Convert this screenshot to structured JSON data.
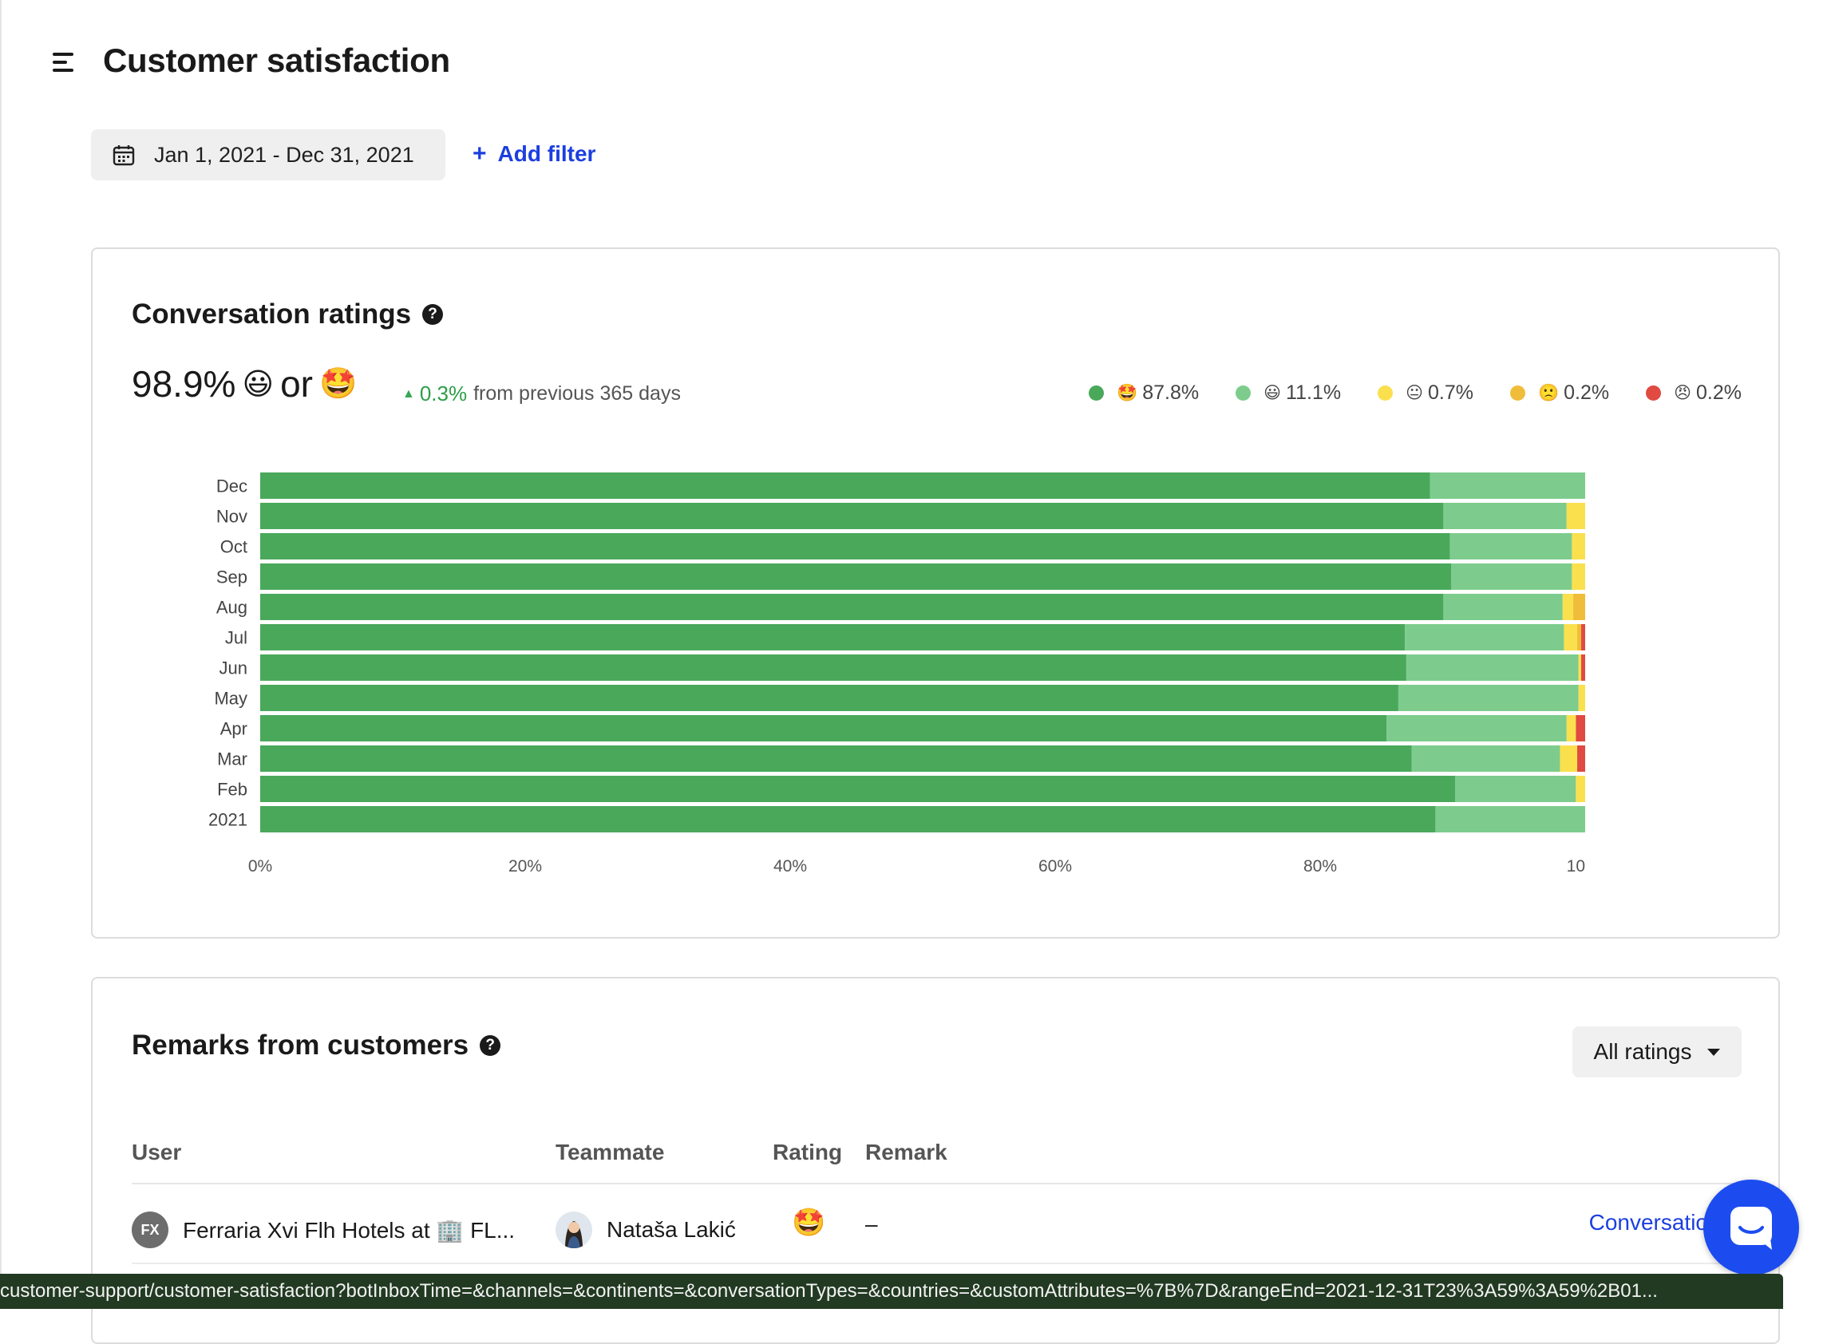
{
  "header": {
    "title": "Customer satisfaction"
  },
  "filters": {
    "date_range": "Jan 1, 2021 - Dec 31, 2021",
    "add_filter": "Add filter",
    "add_filter_icon": "+"
  },
  "ratings_card": {
    "title": "Conversation ratings",
    "help_icon": "?",
    "headline_value": "98.9%",
    "headline_or": "or",
    "headline_emoji_1": "😃",
    "headline_emoji_2": "🤩",
    "change_value": "0.3%",
    "change_text": "from previous 365 days",
    "legend": [
      {
        "emoji": "🤩",
        "value": "87.8%",
        "color": "#4aa85b"
      },
      {
        "emoji": "😃",
        "value": "11.1%",
        "color": "#7dcc8d"
      },
      {
        "emoji": "😐",
        "value": "0.7%",
        "color": "#fbe04e"
      },
      {
        "emoji": "🙁",
        "value": "0.2%",
        "color": "#f0bd3a"
      },
      {
        "emoji": "😠",
        "value": "0.2%",
        "color": "#e04a41"
      }
    ]
  },
  "chart_data": {
    "type": "bar",
    "orientation": "horizontal",
    "stacked": true,
    "categories": [
      "Dec",
      "Nov",
      "Oct",
      "Sep",
      "Aug",
      "Jul",
      "Jun",
      "May",
      "Apr",
      "Mar",
      "Feb",
      "2021"
    ],
    "series": [
      {
        "name": "🤩",
        "color": "#4aa85b",
        "values": [
          88.3,
          89.3,
          89.8,
          89.9,
          89.3,
          86.4,
          86.5,
          85.9,
          85.0,
          86.9,
          90.2,
          88.7
        ]
      },
      {
        "name": "😃",
        "color": "#7dcc8d",
        "values": [
          11.7,
          9.3,
          9.2,
          9.1,
          9.0,
          12.0,
          13.0,
          13.6,
          13.6,
          11.2,
          9.1,
          11.3
        ]
      },
      {
        "name": "😐",
        "color": "#fbe04e",
        "values": [
          0.0,
          1.4,
          1.0,
          1.0,
          0.8,
          1.0,
          0.2,
          0.5,
          0.7,
          1.3,
          0.7,
          0.0
        ]
      },
      {
        "name": "🙁",
        "color": "#f0bd3a",
        "values": [
          0.0,
          0.0,
          0.0,
          0.0,
          0.9,
          0.3,
          0.0,
          0.0,
          0.0,
          0.0,
          0.0,
          0.0
        ]
      },
      {
        "name": "😠",
        "color": "#e04a41",
        "values": [
          0.0,
          0.0,
          0.0,
          0.0,
          0.0,
          0.3,
          0.3,
          0.0,
          0.7,
          0.6,
          0.0,
          0.0
        ]
      }
    ],
    "xlim": [
      0,
      100
    ],
    "xticks": [
      "0%",
      "20%",
      "40%",
      "60%",
      "80%",
      "10"
    ],
    "legend_position": "top-right",
    "grid": false
  },
  "remarks_card": {
    "title": "Remarks from customers",
    "help_icon": "?",
    "filter_select": "All ratings",
    "columns": {
      "user": "User",
      "teammate": "Teammate",
      "rating": "Rating",
      "remark": "Remark"
    },
    "rows": [
      {
        "user_initials": "FX",
        "user": "Ferraria Xvi Flh Hotels at 🏢 FL...",
        "teammate": "Nataša Lakić",
        "rating": "🤩",
        "remark": "–",
        "link": "Conversatio"
      }
    ]
  },
  "status_bar": {
    "url": "customer-support/customer-satisfaction?botInboxTime=&channels=&continents=&conversationTypes=&countries=&customAttributes=%7B%7D&rangeEnd=2021-12-31T23%3A59%3A59%2B01..."
  }
}
